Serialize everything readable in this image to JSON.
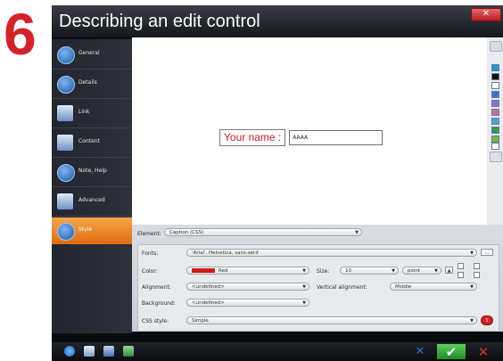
{
  "step_number": "6",
  "window": {
    "title": "Describing an edit control",
    "close_glyph": "✕"
  },
  "sidebar": {
    "items": [
      {
        "label": "General",
        "icon": "general-icon"
      },
      {
        "label": "Details",
        "icon": "details-icon"
      },
      {
        "label": "Link",
        "icon": "link-icon"
      },
      {
        "label": "Content",
        "icon": "content-icon"
      },
      {
        "label": "Note, Help",
        "icon": "note-help-icon"
      },
      {
        "label": "Advanced",
        "icon": "advanced-icon"
      },
      {
        "label": "Style",
        "icon": "style-icon",
        "active": true
      }
    ]
  },
  "preview": {
    "label_text": "Your name :",
    "input_value": "AAAA"
  },
  "palette": {
    "swatches": [
      "#1a9ad7",
      "#111111",
      "#ffffff",
      "#3b6fd0",
      "#8a6ed4",
      "#c06fa2",
      "#4ea0e0",
      "#2f9a57",
      "#6dbb3f",
      "#ffffff"
    ]
  },
  "properties": {
    "element_label": "Element:",
    "element_value": "Caption (CSS)",
    "fonts_label": "Fonts:",
    "fonts_value": "'Arial', Helvetica, sans-serif",
    "color_label": "Color:",
    "color_value": "Red",
    "color_hex": "#d01a1a",
    "size_label": "Size:",
    "size_value": "10",
    "unit_value": "point",
    "alignment_label": "Alignment:",
    "alignment_value": "<undefined>",
    "valign_label": "Vertical alignment:",
    "valign_value": "Middle",
    "background_label": "Background:",
    "background_value": "<undefined>",
    "css_label": "CSS style:",
    "css_value": "Simple"
  },
  "taskbar": {
    "cancel_glyph": "✕",
    "ok_glyph": "✔",
    "back_glyph": "✕"
  }
}
